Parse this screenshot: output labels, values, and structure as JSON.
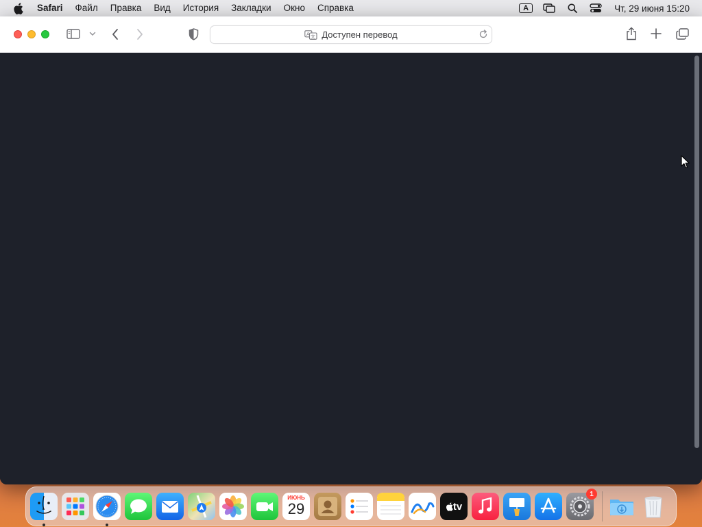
{
  "menubar": {
    "app_name": "Safari",
    "items": [
      "Файл",
      "Правка",
      "Вид",
      "История",
      "Закладки",
      "Окно",
      "Справка"
    ],
    "input_source": "A",
    "clock": "Чт, 29 июня  15:20"
  },
  "toolbar": {
    "address_text": "Доступен перевод"
  },
  "dock": {
    "calendar_month": "ИЮНЬ",
    "calendar_day": "29",
    "appletv_label": "tv",
    "settings_badge": "1"
  },
  "colors": {
    "content_bg": "#1e212a",
    "close": "#fe5f57",
    "minimize": "#febc2e",
    "maximize": "#28c840"
  }
}
